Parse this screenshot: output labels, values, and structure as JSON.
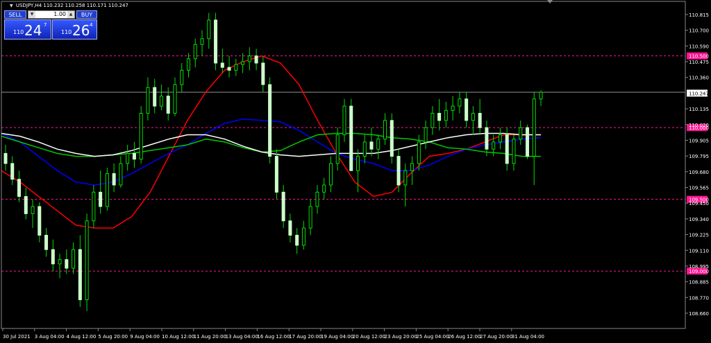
{
  "info": {
    "symbol_line": "USDJPY,H4  110.232 110.258 110.171 110.247"
  },
  "trade": {
    "sell_label": "SELL",
    "buy_label": "BUY",
    "lot_value": "1.00",
    "bid_small": "110",
    "bid_big": "24",
    "bid_sup": "7",
    "ask_small": "110",
    "ask_big": "26",
    "ask_sup": "4"
  },
  "chart_data": {
    "type": "candlestick",
    "symbol": "USDJPY",
    "timeframe": "H4",
    "ohlc_header": {
      "open": 110.232,
      "high": 110.258,
      "low": 110.171,
      "close": 110.247
    },
    "ylim": [
      108.6,
      110.88
    ],
    "y_ticks": [
      "110.815",
      "110.700",
      "110.590",
      "110.475",
      "110.360",
      "110.247",
      "110.135",
      "110.020",
      "109.905",
      "109.795",
      "109.680",
      "109.565",
      "109.450",
      "109.340",
      "109.225",
      "109.110",
      "108.995",
      "108.885",
      "108.770",
      "108.660"
    ],
    "x_ticks": [
      "30 Jul 2021",
      "3 Aug 04:00",
      "4 Aug 12:00",
      "5 Aug 20:00",
      "9 Aug 04:00",
      "10 Aug 12:00",
      "11 Aug 20:00",
      "13 Aug 04:00",
      "16 Aug 12:00",
      "17 Aug 20:00",
      "19 Aug 04:00",
      "20 Aug 12:00",
      "23 Aug 20:00",
      "25 Aug 04:00",
      "26 Aug 12:00",
      "27 Aug 20:00",
      "31 Aug 04:00"
    ],
    "horizontal_levels": [
      {
        "label": "110.500",
        "value": 110.5,
        "color": "#ff1493"
      },
      {
        "label": "110.000",
        "value": 110.0,
        "color": "#ff1493"
      },
      {
        "label": "109.500",
        "value": 109.5,
        "color": "#ff1493"
      },
      {
        "label": "109.000",
        "value": 109.0,
        "color": "#ff1493"
      }
    ],
    "bid_line": {
      "label": "110.247",
      "value": 110.247
    },
    "candles": [
      [
        109.82,
        109.88,
        109.7,
        109.75
      ],
      [
        109.75,
        109.8,
        109.6,
        109.64
      ],
      [
        109.64,
        109.7,
        109.48,
        109.52
      ],
      [
        109.52,
        109.58,
        109.36,
        109.4
      ],
      [
        109.4,
        109.5,
        109.3,
        109.45
      ],
      [
        109.45,
        109.48,
        109.2,
        109.25
      ],
      [
        109.25,
        109.3,
        109.1,
        109.15
      ],
      [
        109.15,
        109.22,
        109.0,
        109.05
      ],
      [
        109.05,
        109.12,
        108.95,
        109.08
      ],
      [
        109.08,
        109.15,
        108.98,
        109.02
      ],
      [
        109.02,
        109.2,
        108.98,
        109.15
      ],
      [
        109.15,
        109.25,
        108.75,
        108.8
      ],
      [
        108.8,
        109.4,
        108.72,
        109.35
      ],
      [
        109.35,
        109.6,
        109.3,
        109.55
      ],
      [
        109.55,
        109.7,
        109.4,
        109.45
      ],
      [
        109.45,
        109.72,
        109.42,
        109.68
      ],
      [
        109.68,
        109.75,
        109.55,
        109.6
      ],
      [
        109.6,
        109.8,
        109.58,
        109.75
      ],
      [
        109.75,
        109.88,
        109.7,
        109.82
      ],
      [
        109.82,
        109.9,
        109.72,
        109.78
      ],
      [
        109.78,
        110.15,
        109.75,
        110.1
      ],
      [
        110.1,
        110.35,
        110.05,
        110.28
      ],
      [
        110.28,
        110.34,
        110.1,
        110.15
      ],
      [
        110.15,
        110.3,
        110.12,
        110.22
      ],
      [
        110.22,
        110.28,
        110.05,
        110.1
      ],
      [
        110.1,
        110.35,
        110.08,
        110.3
      ],
      [
        110.3,
        110.45,
        110.25,
        110.4
      ],
      [
        110.4,
        110.52,
        110.35,
        110.48
      ],
      [
        110.48,
        110.62,
        110.42,
        110.58
      ],
      [
        110.58,
        110.68,
        110.5,
        110.62
      ],
      [
        110.62,
        110.8,
        110.55,
        110.75
      ],
      [
        110.75,
        110.8,
        110.4,
        110.45
      ],
      [
        110.45,
        110.55,
        110.38,
        110.42
      ],
      [
        110.42,
        110.5,
        110.35,
        110.4
      ],
      [
        110.4,
        110.48,
        110.36,
        110.44
      ],
      [
        110.44,
        110.52,
        110.38,
        110.46
      ],
      [
        110.46,
        110.56,
        110.4,
        110.5
      ],
      [
        110.5,
        110.55,
        110.4,
        110.45
      ],
      [
        110.45,
        110.5,
        110.25,
        110.3
      ],
      [
        110.3,
        110.35,
        109.75,
        109.8
      ],
      [
        109.8,
        109.85,
        109.5,
        109.55
      ],
      [
        109.55,
        109.6,
        109.3,
        109.35
      ],
      [
        109.35,
        109.4,
        109.2,
        109.25
      ],
      [
        109.25,
        109.3,
        109.12,
        109.18
      ],
      [
        109.18,
        109.35,
        109.15,
        109.3
      ],
      [
        109.3,
        109.5,
        109.25,
        109.45
      ],
      [
        109.45,
        109.6,
        109.4,
        109.55
      ],
      [
        109.55,
        109.65,
        109.5,
        109.6
      ],
      [
        109.6,
        109.8,
        109.55,
        109.75
      ],
      [
        109.75,
        110.0,
        109.7,
        109.95
      ],
      [
        109.95,
        110.2,
        109.9,
        110.15
      ],
      [
        110.15,
        110.2,
        109.75,
        109.7
      ],
      [
        109.7,
        109.85,
        109.55,
        109.8
      ],
      [
        109.8,
        109.95,
        109.75,
        109.9
      ],
      [
        109.9,
        110.0,
        109.8,
        109.85
      ],
      [
        109.85,
        109.95,
        109.78,
        109.92
      ],
      [
        109.92,
        110.1,
        109.88,
        110.05
      ],
      [
        110.05,
        110.1,
        109.75,
        109.8
      ],
      [
        109.8,
        109.85,
        109.55,
        109.6
      ],
      [
        109.6,
        109.75,
        109.45,
        109.7
      ],
      [
        109.7,
        109.8,
        109.6,
        109.75
      ],
      [
        109.75,
        109.95,
        109.7,
        109.9
      ],
      [
        109.9,
        110.05,
        109.85,
        110.0
      ],
      [
        110.0,
        110.15,
        109.95,
        110.1
      ],
      [
        110.1,
        110.2,
        109.98,
        110.05
      ],
      [
        110.05,
        110.18,
        110.0,
        110.12
      ],
      [
        110.12,
        110.22,
        110.05,
        110.15
      ],
      [
        110.15,
        110.25,
        110.1,
        110.2
      ],
      [
        110.2,
        110.25,
        110.0,
        110.05
      ],
      [
        110.05,
        110.15,
        109.95,
        110.1
      ],
      [
        110.1,
        110.2,
        109.95,
        110.0
      ],
      [
        110.0,
        110.05,
        109.8,
        109.85
      ],
      [
        109.85,
        109.95,
        109.8,
        109.9
      ],
      [
        109.9,
        110.0,
        109.85,
        109.95
      ],
      [
        109.95,
        110.0,
        109.7,
        109.75
      ],
      [
        109.75,
        109.95,
        109.7,
        109.92
      ],
      [
        109.92,
        110.05,
        109.88,
        110.0
      ],
      [
        110.0,
        110.02,
        109.78,
        109.8
      ],
      [
        109.8,
        110.25,
        109.6,
        110.2
      ],
      [
        110.2,
        110.26,
        110.15,
        110.247
      ]
    ],
    "moving_averages": [
      {
        "color": "#ff0000",
        "values": [
          109.7,
          109.62,
          109.52,
          109.42,
          109.32,
          109.3,
          109.3,
          109.38,
          109.55,
          109.8,
          110.05,
          110.25,
          110.4,
          110.46,
          110.5,
          110.45,
          110.3,
          110.05,
          109.82,
          109.62,
          109.52,
          109.55,
          109.68,
          109.8,
          109.82,
          109.85,
          109.9,
          109.95,
          109.95,
          109.95
        ]
      },
      {
        "color": "#0000ff",
        "values": [
          109.96,
          109.9,
          109.8,
          109.7,
          109.62,
          109.6,
          109.62,
          109.68,
          109.75,
          109.82,
          109.88,
          109.96,
          110.03,
          110.06,
          110.05,
          110.04,
          109.98,
          109.9,
          109.82,
          109.78,
          109.75,
          109.7,
          109.7,
          109.74,
          109.8,
          109.85,
          109.88,
          109.9,
          109.92,
          109.93
        ]
      },
      {
        "color": "#00c800",
        "values": [
          109.94,
          109.9,
          109.86,
          109.82,
          109.8,
          109.8,
          109.81,
          109.82,
          109.84,
          109.86,
          109.88,
          109.92,
          109.9,
          109.86,
          109.83,
          109.84,
          109.9,
          109.95,
          109.96,
          109.96,
          109.95,
          109.93,
          109.92,
          109.9,
          109.86,
          109.85,
          109.83,
          109.82,
          109.8,
          109.8
        ]
      },
      {
        "color": "#ffffff",
        "values": [
          109.96,
          109.94,
          109.9,
          109.85,
          109.82,
          109.8,
          109.81,
          109.84,
          109.88,
          109.92,
          109.95,
          109.95,
          109.92,
          109.87,
          109.83,
          109.81,
          109.8,
          109.81,
          109.82,
          109.82,
          109.82,
          109.84,
          109.87,
          109.9,
          109.93,
          109.95,
          109.96,
          109.96,
          109.95,
          109.95
        ]
      }
    ]
  }
}
